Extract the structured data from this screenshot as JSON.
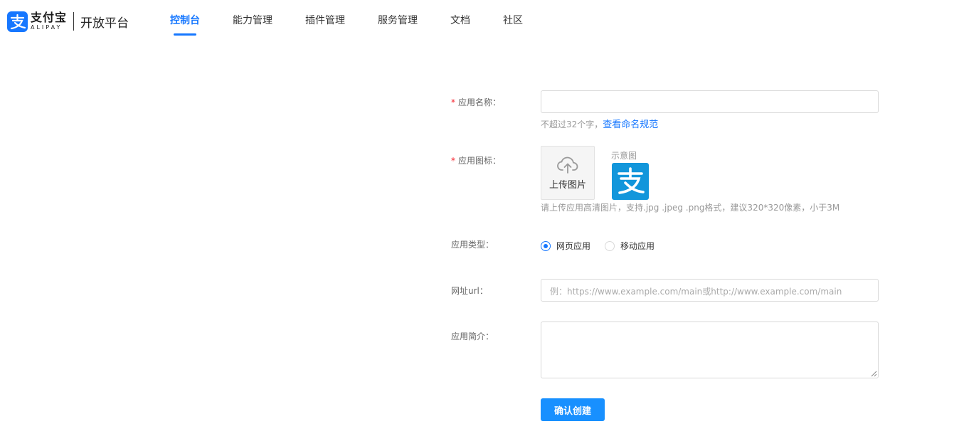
{
  "header": {
    "logo_cn": "支付宝",
    "logo_en": "ALIPAY",
    "platform_title": "开放平台",
    "brand_color": "#1677ff",
    "nav": [
      {
        "label": "控制台",
        "active": true
      },
      {
        "label": "能力管理",
        "active": false
      },
      {
        "label": "插件管理",
        "active": false
      },
      {
        "label": "服务管理",
        "active": false
      },
      {
        "label": "文档",
        "active": false
      },
      {
        "label": "社区",
        "active": false
      }
    ]
  },
  "form": {
    "app_name": {
      "label": "应用名称：",
      "value": "",
      "hint": "不超过32个字，",
      "hint_link": "查看命名规范"
    },
    "app_icon": {
      "label": "应用图标：",
      "upload_label": "上传图片",
      "upload_icon": "cloud-upload-icon",
      "sample_label": "示意图",
      "sample_icon": "alipay-logo-icon",
      "hint": "请上传应用高清图片，支持.jpg .jpeg .png格式，建议320*320像素，小于3M"
    },
    "app_type": {
      "label": "应用类型：",
      "options": [
        {
          "label": "网页应用",
          "selected": true
        },
        {
          "label": "移动应用",
          "selected": false
        }
      ]
    },
    "url": {
      "label": "网址url：",
      "value": "",
      "placeholder": "例：https://www.example.com/main或http://www.example.com/main"
    },
    "intro": {
      "label": "应用简介：",
      "value": ""
    },
    "submit_label": "确认创建"
  }
}
